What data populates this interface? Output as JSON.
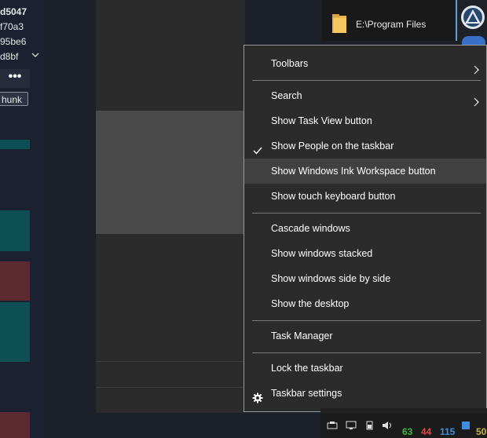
{
  "git_panel": {
    "hashes": [
      "d5047",
      "f70a3",
      "95be6",
      "d8bf"
    ],
    "more_label": "•••",
    "hunk_label": "hunk"
  },
  "explorer": {
    "path_label": "E:\\Program Files"
  },
  "context_menu": {
    "items": [
      {
        "label": "Toolbars",
        "submenu": true
      },
      {
        "label": "Search",
        "submenu": true
      },
      {
        "label": "Show Task View button"
      },
      {
        "label": "Show People on the taskbar",
        "checked": true
      },
      {
        "label": "Show Windows Ink Workspace button",
        "highlighted": true
      },
      {
        "label": "Show touch keyboard button"
      },
      {
        "label": "Cascade windows"
      },
      {
        "label": "Show windows stacked"
      },
      {
        "label": "Show windows side by side"
      },
      {
        "label": "Show the desktop"
      },
      {
        "label": "Task Manager"
      },
      {
        "label": "Lock the taskbar"
      },
      {
        "label": "Taskbar settings",
        "icon": "gear-icon"
      }
    ]
  },
  "tray": {
    "numbers": [
      {
        "value": "63",
        "color": "#3db83d"
      },
      {
        "value": "44",
        "color": "#e04848"
      },
      {
        "value": "115",
        "color": "#3d8ee0"
      },
      {
        "value": "50",
        "color": "#c8b43c"
      }
    ]
  },
  "colors": {
    "menu_bg": "#2b2b2b",
    "menu_hover": "#414141",
    "teal": "#0e4e55",
    "maroon": "#5e2a32"
  }
}
